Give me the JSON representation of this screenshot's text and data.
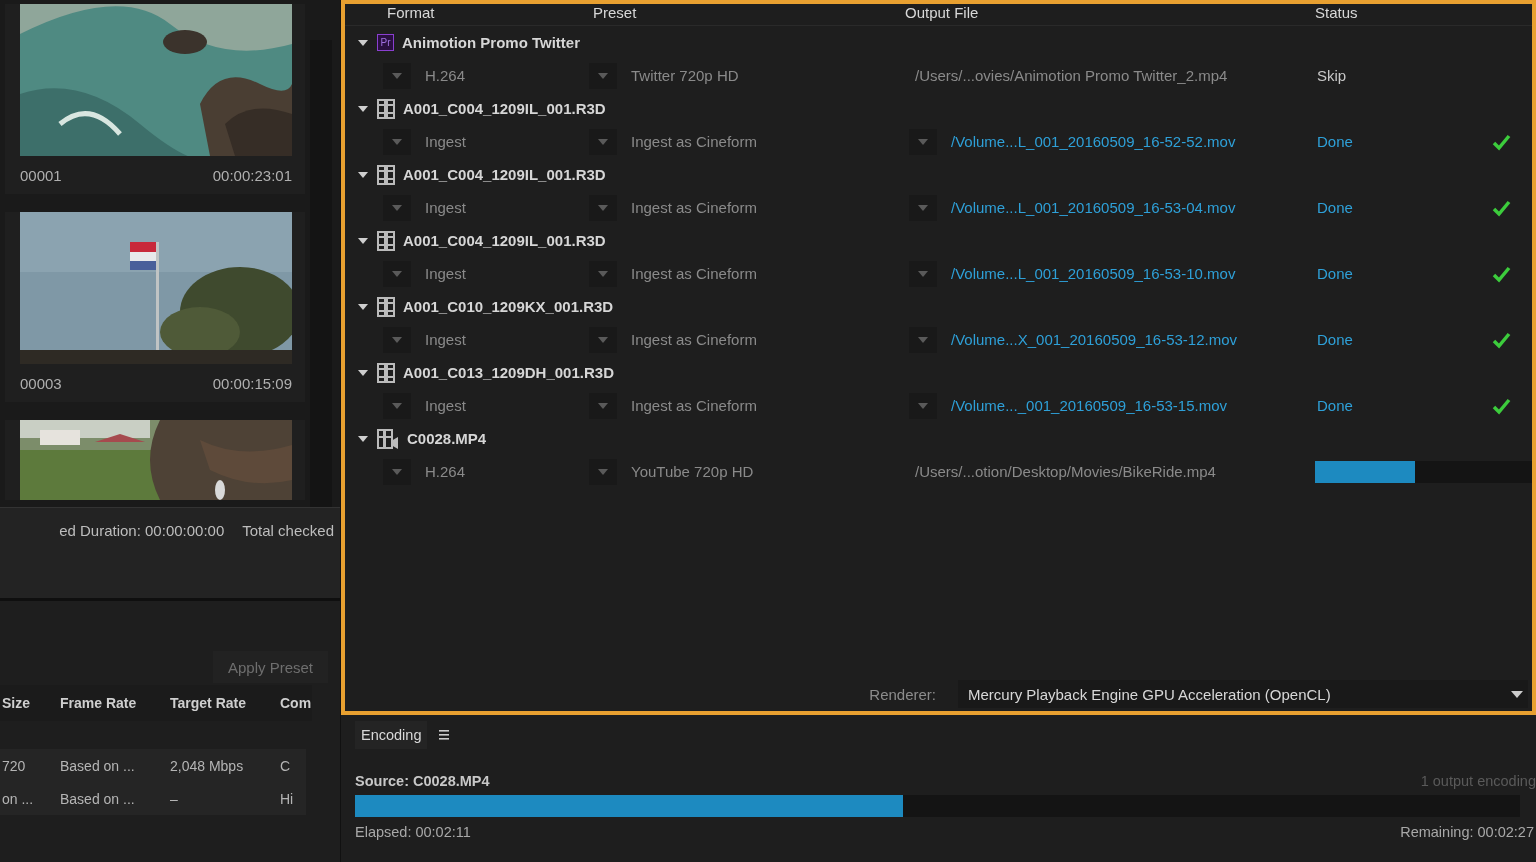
{
  "media_browser": {
    "thumbnails": [
      {
        "kind": "picture",
        "name": "00001",
        "duration": "00:00:23:01"
      },
      {
        "kind": "picture",
        "name": "00003",
        "duration": "00:00:15:09"
      },
      {
        "kind": "picture"
      }
    ],
    "summary": [
      "ed Duration: 00:00:00:00",
      "Total checked"
    ]
  },
  "preset_browser": {
    "apply_button": "Apply Preset",
    "columns": [
      "Size",
      "Frame Rate",
      "Target Rate",
      "Com"
    ],
    "rows": [
      [
        "720",
        "Based on ...",
        "2,048 Mbps",
        "C"
      ],
      [
        "on ...",
        "Based on ...",
        "–",
        "Hi"
      ]
    ]
  },
  "queue": {
    "columns": [
      "Format",
      "Preset",
      "Output File",
      "Status"
    ],
    "items": [
      {
        "kind": "premiere",
        "badge": "Pr",
        "name": "Animotion Promo Twitter",
        "expanded": true,
        "outputs": [
          {
            "kind": "skip",
            "format": "H.264",
            "preset": "Twitter 720p HD",
            "output_file": "/Users/...ovies/Animotion Promo Twitter_2.mp4",
            "status": "Skip"
          }
        ]
      },
      {
        "kind": "film",
        "name": "A001_C004_1209IL_001.R3D",
        "expanded": true,
        "outputs": [
          {
            "kind": "done",
            "format": "Ingest",
            "preset": "Ingest as Cineform",
            "output_file": "/Volume...L_001_20160509_16-52-52.mov",
            "status": "Done"
          }
        ]
      },
      {
        "kind": "film",
        "name": "A001_C004_1209IL_001.R3D",
        "expanded": true,
        "outputs": [
          {
            "kind": "done",
            "format": "Ingest",
            "preset": "Ingest as Cineform",
            "output_file": "/Volume...L_001_20160509_16-53-04.mov",
            "status": "Done"
          }
        ]
      },
      {
        "kind": "film",
        "name": "A001_C004_1209IL_001.R3D",
        "expanded": true,
        "outputs": [
          {
            "kind": "done",
            "format": "Ingest",
            "preset": "Ingest as Cineform",
            "output_file": "/Volume...L_001_20160509_16-53-10.mov",
            "status": "Done"
          }
        ]
      },
      {
        "kind": "film",
        "name": "A001_C010_1209KX_001.R3D",
        "expanded": true,
        "outputs": [
          {
            "kind": "done",
            "format": "Ingest",
            "preset": "Ingest as Cineform",
            "output_file": "/Volume...X_001_20160509_16-53-12.mov",
            "status": "Done"
          }
        ]
      },
      {
        "kind": "film",
        "name": "A001_C013_1209DH_001.R3D",
        "expanded": true,
        "outputs": [
          {
            "kind": "done",
            "format": "Ingest",
            "preset": "Ingest as Cineform",
            "output_file": "/Volume..._001_20160509_16-53-15.mov",
            "status": "Done"
          }
        ]
      },
      {
        "kind": "video",
        "name": "C0028.MP4",
        "expanded": true,
        "outputs": [
          {
            "kind": "encoding",
            "format": "H.264",
            "preset": "YouTube 720p HD",
            "output_file": "/Users/...otion/Desktop/Movies/BikeRide.mp4",
            "level": 0.46
          }
        ]
      }
    ],
    "renderer_label": "Renderer:",
    "renderer": "Mercury Playback Engine GPU Acceleration (OpenCL)"
  },
  "encoding": {
    "title": "Encoding",
    "source": "Source: C0028.MP4",
    "outputs_count": "1 output encoding",
    "level": 0.47,
    "elapsed": "Elapsed: 00:02:11",
    "remaining": "Remaining: 00:02:27"
  }
}
